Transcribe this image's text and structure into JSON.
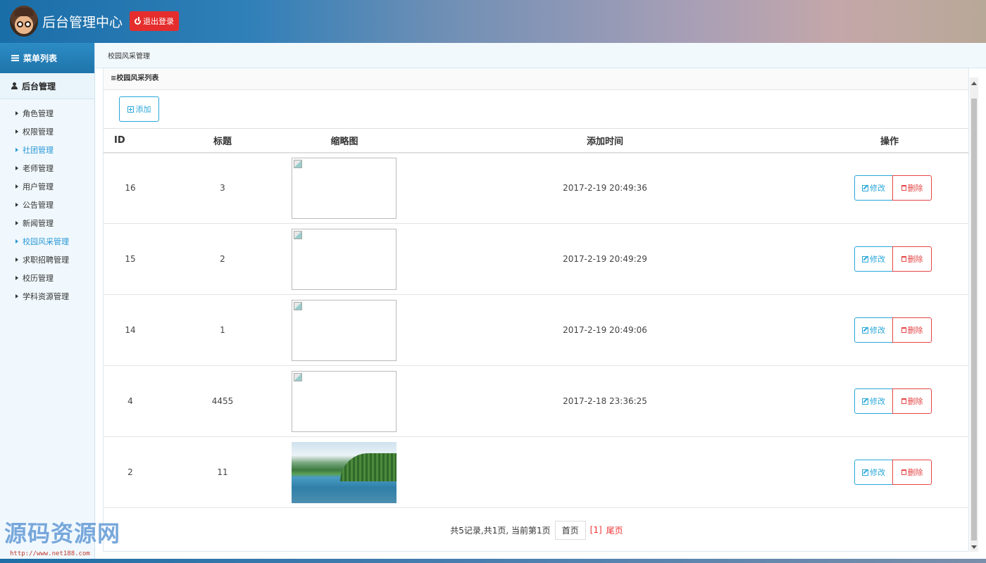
{
  "header": {
    "title": "后台管理中心",
    "logout_label": "退出登录"
  },
  "sidebar": {
    "menu_title": "菜单列表",
    "group_title": "后台管理",
    "items": [
      {
        "label": "角色管理",
        "active": false
      },
      {
        "label": "权限管理",
        "active": false
      },
      {
        "label": "社团管理",
        "active": true
      },
      {
        "label": "老师管理",
        "active": false
      },
      {
        "label": "用户管理",
        "active": false
      },
      {
        "label": "公告管理",
        "active": false
      },
      {
        "label": "新闻管理",
        "active": false
      },
      {
        "label": "校园风采管理",
        "active": true
      },
      {
        "label": "求职招聘管理",
        "active": false
      },
      {
        "label": "校历管理",
        "active": false
      },
      {
        "label": "学科资源管理",
        "active": false
      }
    ]
  },
  "breadcrumb": "校园风采管理",
  "panel": {
    "title": "≡校园风采列表",
    "add_label": "添加"
  },
  "table": {
    "columns": [
      "ID",
      "标题",
      "缩略图",
      "添加时间",
      "操作"
    ],
    "rows": [
      {
        "id": "16",
        "title": "3",
        "thumb": "broken",
        "time": "2017-2-19 20:49:36"
      },
      {
        "id": "15",
        "title": "2",
        "thumb": "broken",
        "time": "2017-2-19 20:49:29"
      },
      {
        "id": "14",
        "title": "1",
        "thumb": "broken",
        "time": "2017-2-19 20:49:06"
      },
      {
        "id": "4",
        "title": "4455",
        "thumb": "broken",
        "time": "2017-2-18 23:36:25"
      },
      {
        "id": "2",
        "title": "11",
        "thumb": "photo",
        "time": ""
      }
    ],
    "edit_label": "修改",
    "delete_label": "删除"
  },
  "pager": {
    "summary": "共5记录,共1页, 当前第1页",
    "first_label": "首页",
    "current": "[1]",
    "last_label": "尾页"
  },
  "watermark": {
    "text": "源码资源网",
    "url": "http://www.net188.com"
  },
  "colors": {
    "accent": "#2aa7d8",
    "danger": "#e54545",
    "logout": "#e52d2d"
  }
}
